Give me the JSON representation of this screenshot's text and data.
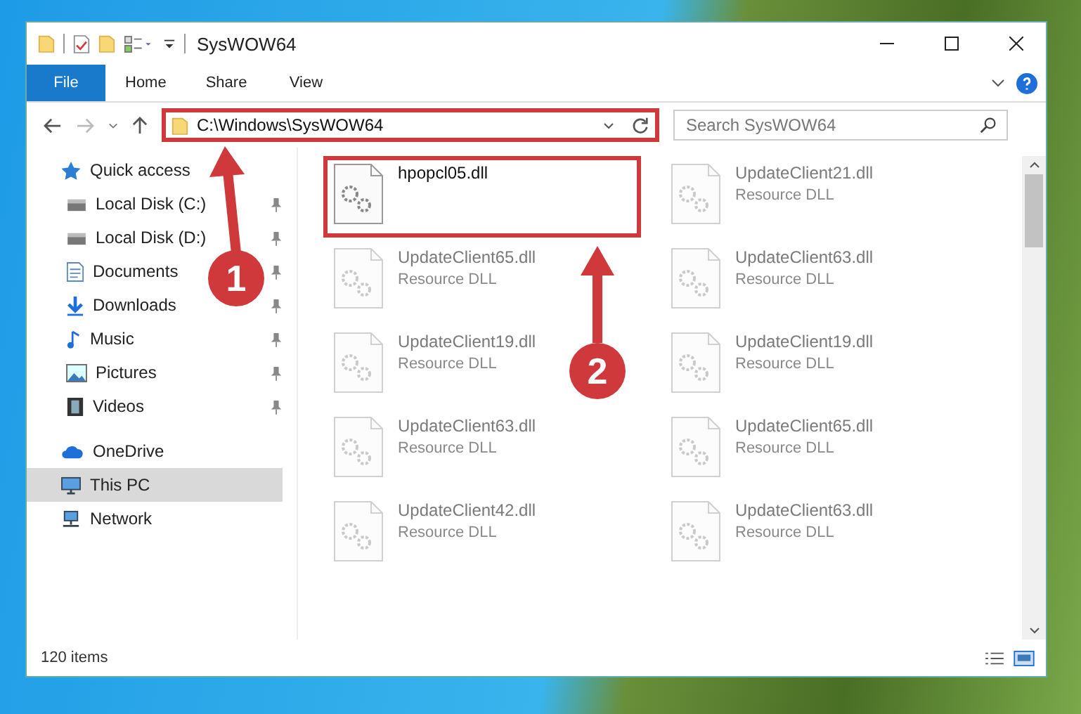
{
  "window": {
    "title": "SysWOW64"
  },
  "ribbon_tabs": [
    {
      "label": "File",
      "selected": true
    },
    {
      "label": "Home",
      "selected": false
    },
    {
      "label": "Share",
      "selected": false
    },
    {
      "label": "View",
      "selected": false
    }
  ],
  "address": {
    "path": "C:\\Windows\\SysWOW64",
    "highlighted": true
  },
  "search": {
    "placeholder": "Search SysWOW64"
  },
  "sidebar": {
    "items": [
      {
        "label": "Quick access",
        "kind": "star",
        "pinned": false,
        "selected": false
      },
      {
        "label": "Local Disk (C:)",
        "kind": "drive",
        "pinned": true,
        "selected": false
      },
      {
        "label": "Local Disk (D:)",
        "kind": "drive",
        "pinned": true,
        "selected": false
      },
      {
        "label": "Documents",
        "kind": "documents",
        "pinned": true,
        "selected": false
      },
      {
        "label": "Downloads",
        "kind": "downloads",
        "pinned": true,
        "selected": false
      },
      {
        "label": "Music",
        "kind": "music",
        "pinned": true,
        "selected": false
      },
      {
        "label": "Pictures",
        "kind": "pictures",
        "pinned": true,
        "selected": false
      },
      {
        "label": "Videos",
        "kind": "videos",
        "pinned": true,
        "selected": false
      },
      {
        "label": "OneDrive",
        "kind": "cloud",
        "pinned": false,
        "selected": false
      },
      {
        "label": "This PC",
        "kind": "pc",
        "pinned": false,
        "selected": true
      },
      {
        "label": "Network",
        "kind": "network",
        "pinned": false,
        "selected": false
      }
    ]
  },
  "files": [
    {
      "name": "hpopcl05.dll",
      "blurred": false,
      "highlighted": true
    },
    {
      "name": "UpdateClient21.dll",
      "type": "Resource DLL",
      "blurred": true,
      "highlighted": false
    },
    {
      "name": "UpdateClient65.dll",
      "type": "Resource DLL",
      "blurred": true,
      "highlighted": false
    },
    {
      "name": "UpdateClient63.dll",
      "type": "Resource DLL",
      "blurred": true,
      "highlighted": false
    },
    {
      "name": "UpdateClient19.dll",
      "type": "Resource DLL",
      "blurred": true,
      "highlighted": false
    },
    {
      "name": "UpdateClient19.dll",
      "type": "Resource DLL",
      "blurred": true,
      "highlighted": false
    },
    {
      "name": "UpdateClient63.dll",
      "type": "Resource DLL",
      "blurred": true,
      "highlighted": false
    },
    {
      "name": "UpdateClient65.dll",
      "type": "Resource DLL",
      "blurred": true,
      "highlighted": false
    },
    {
      "name": "UpdateClient42.dll",
      "type": "Resource DLL",
      "blurred": true,
      "highlighted": false
    },
    {
      "name": "UpdateClient63.dll",
      "type": "Resource DLL",
      "blurred": true,
      "highlighted": false
    }
  ],
  "status_bar": {
    "item_count": "120 items"
  },
  "callouts": [
    {
      "number": "1"
    },
    {
      "number": "2"
    }
  ]
}
